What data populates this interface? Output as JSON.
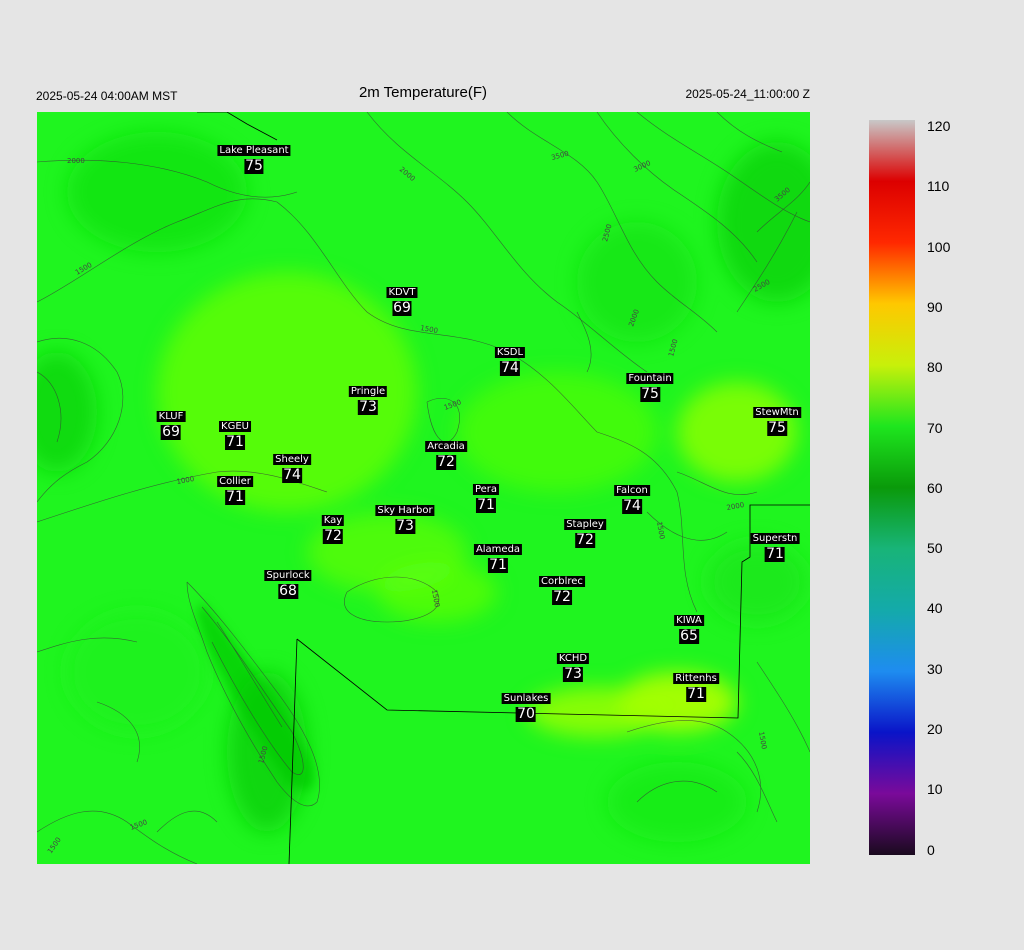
{
  "header": {
    "left": "2025-05-24 04:00AM MST",
    "title": "2m Temperature(F)",
    "right": "2025-05-24_11:00:00 Z"
  },
  "contour_labels": [
    "2000",
    "1500",
    "2000",
    "3500",
    "3000",
    "2500",
    "3500",
    "2500",
    "2000",
    "1500",
    "1500",
    "1500",
    "1000",
    "2000",
    "1500",
    "1500",
    "1500",
    "1500",
    "1500",
    "1500"
  ],
  "stations": [
    {
      "name": "Lake Pleasant",
      "value": "75"
    },
    {
      "name": "KDVT",
      "value": "69"
    },
    {
      "name": "KSDL",
      "value": "74"
    },
    {
      "name": "Fountain",
      "value": "75"
    },
    {
      "name": "Pringle",
      "value": "73"
    },
    {
      "name": "KLUF",
      "value": "69"
    },
    {
      "name": "KGEU",
      "value": "71"
    },
    {
      "name": "StewMtn",
      "value": "75"
    },
    {
      "name": "Arcadia",
      "value": "72"
    },
    {
      "name": "Sheely",
      "value": "74"
    },
    {
      "name": "Collier",
      "value": "71"
    },
    {
      "name": "Pera",
      "value": "71"
    },
    {
      "name": "Falcon",
      "value": "74"
    },
    {
      "name": "Sky Harbor",
      "value": "73"
    },
    {
      "name": "Kay",
      "value": "72"
    },
    {
      "name": "Stapley",
      "value": "72"
    },
    {
      "name": "Superstn",
      "value": "71"
    },
    {
      "name": "Alameda",
      "value": "71"
    },
    {
      "name": "Spurlock",
      "value": "68"
    },
    {
      "name": "Corblrec",
      "value": "72"
    },
    {
      "name": "KIWA",
      "value": "65"
    },
    {
      "name": "KCHD",
      "value": "73"
    },
    {
      "name": "Rittenhs",
      "value": "71"
    },
    {
      "name": "Sunlakes",
      "value": "70"
    }
  ],
  "colorbar": {
    "labels": [
      "120",
      "110",
      "100",
      "90",
      "80",
      "70",
      "60",
      "50",
      "40",
      "30",
      "20",
      "10",
      "0"
    ],
    "colors": {
      "c0": "#1a0a1e",
      "c10": "#7a0a9a",
      "c20": "#0a14c8",
      "c30": "#1e8cf0",
      "c40": "#14aaaa",
      "c50": "#18b478",
      "c60": "#0a9a0a",
      "c70": "#1ee61e",
      "c80": "#c8f00a",
      "c90": "#ffc800",
      "c100": "#ff2800",
      "c110": "#dc0000",
      "c120": "#c8c8c8"
    }
  },
  "map_colors": {
    "base": "#1ff51f",
    "dark": "#10dc10",
    "light": "#78ff00",
    "yellow": "#b8ff00"
  }
}
